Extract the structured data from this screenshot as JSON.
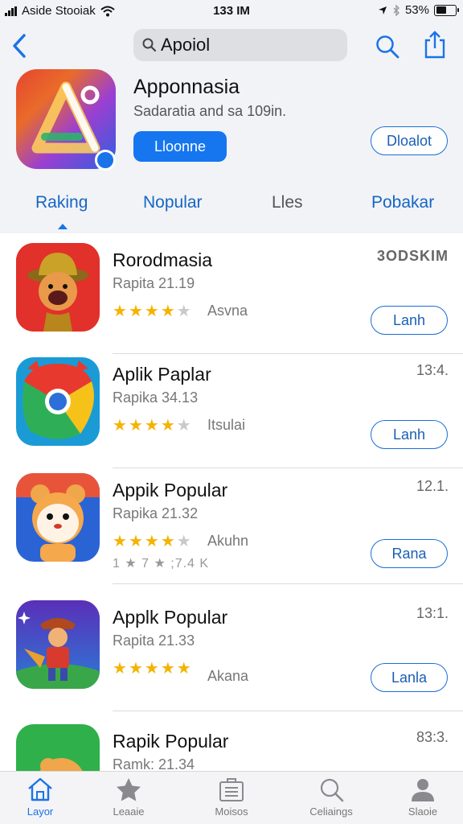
{
  "status_bar": {
    "carrier": "Aside Stooiak",
    "time": "133 IM",
    "battery": "53%",
    "battery_level": 0.55
  },
  "header": {
    "search_value": "Apoiol",
    "back_icon": "chevron-left-icon",
    "search_icon": "search-icon",
    "share_icon": "share-icon"
  },
  "featured": {
    "title": "Apponnasia",
    "subtitle": "Sadaratia and sa 109in.",
    "primary_button": "Lloonne",
    "secondary_button": "Dloalot"
  },
  "tabs": [
    {
      "label": "Raking",
      "active": true
    },
    {
      "label": "Nopular",
      "active": false
    },
    {
      "label": "Lles",
      "active": false
    },
    {
      "label": "Pobakar",
      "active": false
    }
  ],
  "apps": [
    {
      "name": "Rorodmasia",
      "version": "Rapita 21.19",
      "rating": 4,
      "rating_label": "Asvna",
      "extra": "",
      "time": "3ODSKIM",
      "action": "Lanh"
    },
    {
      "name": "Aplik Paplar",
      "version": "Rapika 34.13",
      "rating": 3.5,
      "rating_label": "Itsulai",
      "extra": "",
      "time": "13:4.",
      "action": "Lanh"
    },
    {
      "name": "Appik Popular",
      "version": "Rapika 21.32",
      "rating": 4,
      "rating_label": "Akuhn",
      "extra": "1 ★ 7 ★ ;7.4 K",
      "time": "12.1.",
      "action": "Rana"
    },
    {
      "name": "Applk Popular",
      "version": "Rapita 21.33",
      "rating": 4.5,
      "rating_label": "Akana",
      "extra": "",
      "time": "13:1.",
      "action": "Lanla"
    },
    {
      "name": "Rapik Popular",
      "version": "Ramk: 21.34",
      "rating": 0,
      "rating_label": "",
      "extra": "",
      "time": "83:3.",
      "action": ""
    }
  ],
  "tab_bar": [
    {
      "label": "Layor",
      "icon": "home-icon",
      "active": true
    },
    {
      "label": "Leaaie",
      "icon": "star-icon",
      "active": false
    },
    {
      "label": "Moisos",
      "icon": "briefcase-list-icon",
      "active": false
    },
    {
      "label": "Celiaings",
      "icon": "search-icon",
      "active": false
    },
    {
      "label": "Slaoie",
      "icon": "person-icon",
      "active": false
    }
  ],
  "colors": {
    "accent": "#1a73e8",
    "header_bg": "#f2f3f7",
    "star": "#f5b301"
  }
}
